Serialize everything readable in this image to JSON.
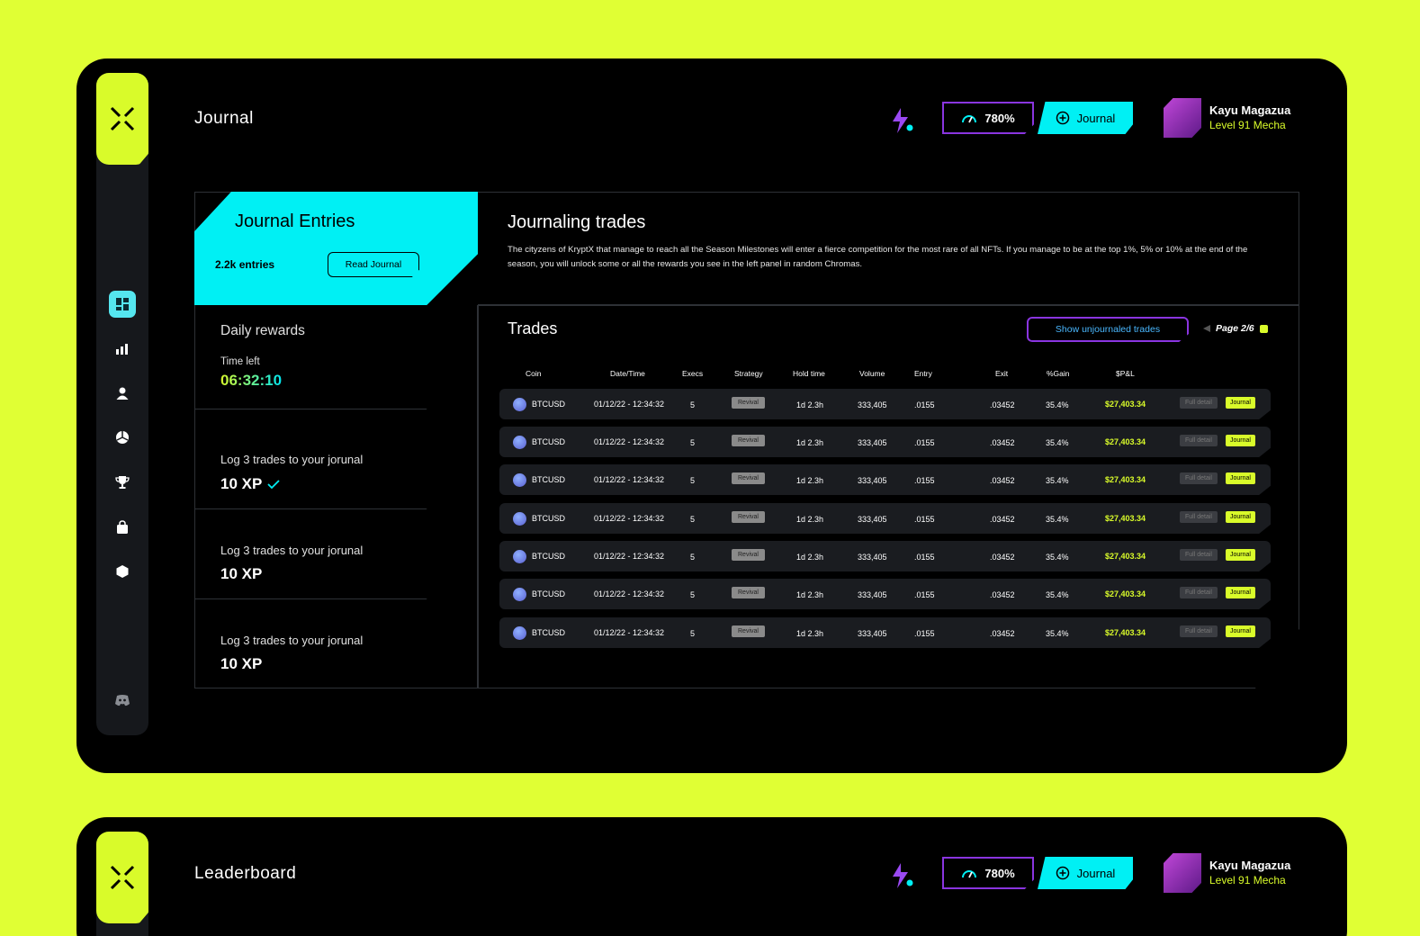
{
  "app": {
    "user": {
      "name": "Kayu Magazua",
      "level": "Level 91 Mecha"
    },
    "stat_value": "780%",
    "journal_button": "Journal"
  },
  "panel1": {
    "title": "Journal",
    "journal_entries": {
      "heading": "Journal Entries",
      "count": "2.2k entries",
      "read_button": "Read Journal"
    },
    "journaling": {
      "heading": "Journaling trades",
      "description": "The cityzens of KryptX that manage to reach all the Season Milestones will enter a fierce competition for the most rare of all NFTs. If you manage to be at the top 1%, 5% or 10% at the end of the season, you will unlock some or all the rewards you see in the left panel in random Chromas."
    },
    "daily": {
      "heading": "Daily rewards",
      "time_label": "Time left",
      "time_value": "06:32:10"
    },
    "tasks": [
      {
        "label": "Log 3 trades to your jorunal",
        "xp": "10 XP",
        "done": true
      },
      {
        "label": "Log 3 trades to your jorunal",
        "xp": "10 XP",
        "done": false
      },
      {
        "label": "Log 3 trades to your jorunal",
        "xp": "10 XP",
        "done": false
      }
    ],
    "trades": {
      "heading": "Trades",
      "unjournaled_button": "Show unjournaled trades",
      "page": "Page 2/6",
      "columns": [
        "Coin",
        "Date/Time",
        "Execs",
        "Strategy",
        "Hold time",
        "Volume",
        "Entry",
        "Exit",
        "%Gain",
        "$P&L"
      ],
      "rows": [
        {
          "coin": "BTCUSD",
          "datetime": "01/12/22 - 12:34:32",
          "execs": "5",
          "strategy": "Revival",
          "hold": "1d 2.3h",
          "volume": "333,405",
          "entry": ".0155",
          "exit": ".03452",
          "gain": "35.4%",
          "pnl": "$27,403.34",
          "detail": "Full detail",
          "journal": "Journal"
        },
        {
          "coin": "BTCUSD",
          "datetime": "01/12/22 - 12:34:32",
          "execs": "5",
          "strategy": "Revival",
          "hold": "1d 2.3h",
          "volume": "333,405",
          "entry": ".0155",
          "exit": ".03452",
          "gain": "35.4%",
          "pnl": "$27,403.34",
          "detail": "Full detail",
          "journal": "Journal"
        },
        {
          "coin": "BTCUSD",
          "datetime": "01/12/22 - 12:34:32",
          "execs": "5",
          "strategy": "Revival",
          "hold": "1d 2.3h",
          "volume": "333,405",
          "entry": ".0155",
          "exit": ".03452",
          "gain": "35.4%",
          "pnl": "$27,403.34",
          "detail": "Full detail",
          "journal": "Journal"
        },
        {
          "coin": "BTCUSD",
          "datetime": "01/12/22 - 12:34:32",
          "execs": "5",
          "strategy": "Revival",
          "hold": "1d 2.3h",
          "volume": "333,405",
          "entry": ".0155",
          "exit": ".03452",
          "gain": "35.4%",
          "pnl": "$27,403.34",
          "detail": "Full detail",
          "journal": "Journal"
        },
        {
          "coin": "BTCUSD",
          "datetime": "01/12/22 - 12:34:32",
          "execs": "5",
          "strategy": "Revival",
          "hold": "1d 2.3h",
          "volume": "333,405",
          "entry": ".0155",
          "exit": ".03452",
          "gain": "35.4%",
          "pnl": "$27,403.34",
          "detail": "Full detail",
          "journal": "Journal"
        },
        {
          "coin": "BTCUSD",
          "datetime": "01/12/22 - 12:34:32",
          "execs": "5",
          "strategy": "Revival",
          "hold": "1d 2.3h",
          "volume": "333,405",
          "entry": ".0155",
          "exit": ".03452",
          "gain": "35.4%",
          "pnl": "$27,403.34",
          "detail": "Full detail",
          "journal": "Journal"
        },
        {
          "coin": "BTCUSD",
          "datetime": "01/12/22 - 12:34:32",
          "execs": "5",
          "strategy": "Revival",
          "hold": "1d 2.3h",
          "volume": "333,405",
          "entry": ".0155",
          "exit": ".03452",
          "gain": "35.4%",
          "pnl": "$27,403.34",
          "detail": "Full detail",
          "journal": "Journal"
        }
      ]
    }
  },
  "panel2": {
    "title": "Leaderboard"
  },
  "sidebar_icons": [
    "dashboard-icon",
    "bar-chart-icon",
    "user-icon",
    "pie-chart-icon",
    "trophy-icon",
    "bag-icon",
    "hexagon-icon",
    "discord-icon"
  ],
  "colors": {
    "background": "#e0ff34",
    "accent_lime": "#d9fb2a",
    "accent_cyan": "#00f0f4",
    "accent_purple": "#8a35e0"
  }
}
